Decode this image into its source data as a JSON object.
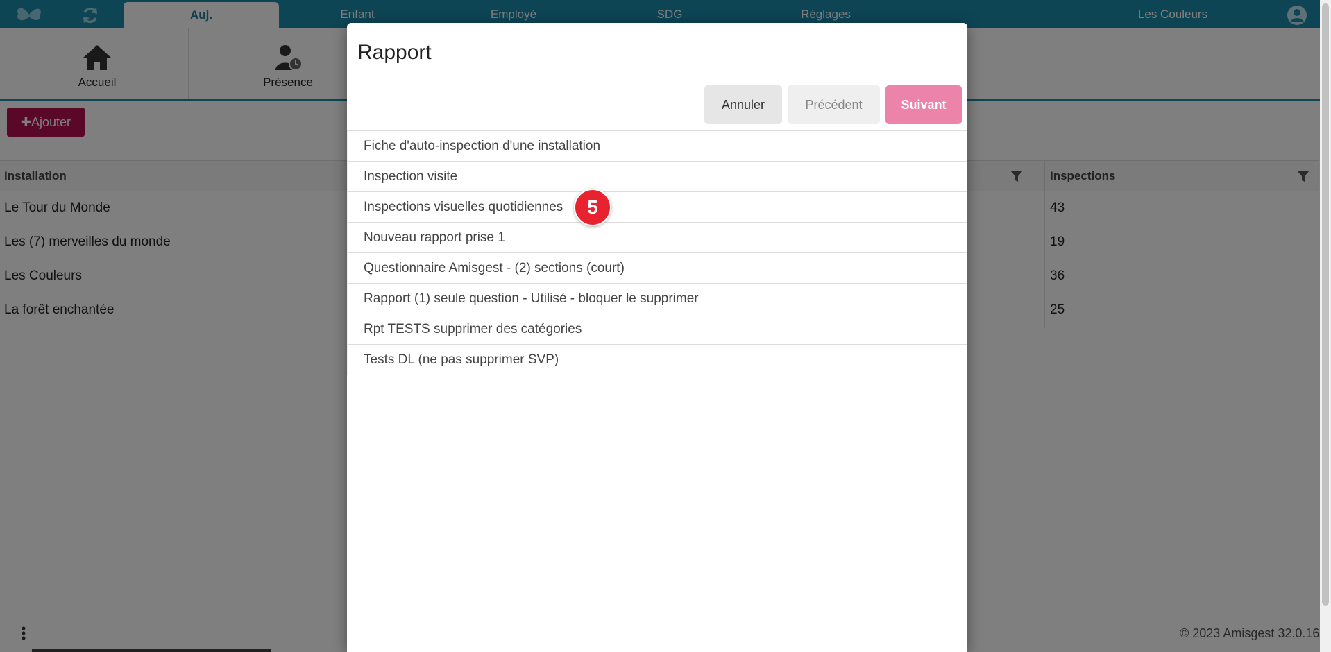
{
  "nav": {
    "tabs": [
      {
        "label": "Auj."
      },
      {
        "label": "Enfant"
      },
      {
        "label": "Employé"
      },
      {
        "label": "SDG"
      },
      {
        "label": "Réglages"
      }
    ],
    "org_name": "Les Couleurs",
    "colors": {
      "bar": "#1a8aaa",
      "active_text": "#1a7fa0"
    }
  },
  "toolbar": {
    "items": [
      {
        "label": "Accueil",
        "icon": "home-icon"
      },
      {
        "label": "Présence",
        "icon": "user-clock-icon"
      }
    ]
  },
  "add_button": {
    "label": "Ajouter",
    "icon": "plus-icon",
    "color": "#b3124f"
  },
  "table": {
    "columns": [
      "Installation",
      "Inspections"
    ],
    "rows": [
      {
        "installation": "Le Tour du Monde",
        "inspections": "43"
      },
      {
        "installation": "Les (7) merveilles du monde",
        "inspections": "19"
      },
      {
        "installation": "Les Couleurs",
        "inspections": "36"
      },
      {
        "installation": "La forêt enchantée",
        "inspections": "25"
      }
    ]
  },
  "footer": {
    "copyright": "© 2023 Amisgest 32.0.16"
  },
  "modal": {
    "title": "Rapport",
    "buttons": {
      "cancel": "Annuler",
      "previous": "Précédent",
      "next": "Suivant"
    },
    "next_color": "#ec83a9",
    "reports": [
      "Fiche d'auto-inspection d'une installation",
      "Inspection visite",
      "Inspections visuelles quotidiennes",
      "Nouveau rapport prise 1",
      "Questionnaire Amisgest - (2) sections (court)",
      "Rapport (1) seule question - Utilisé - bloquer le supprimer",
      "Rpt TESTS supprimer des catégories",
      "Tests DL (ne pas supprimer SVP)"
    ]
  },
  "step_marker": {
    "label": "5",
    "color": "#e8232f"
  }
}
